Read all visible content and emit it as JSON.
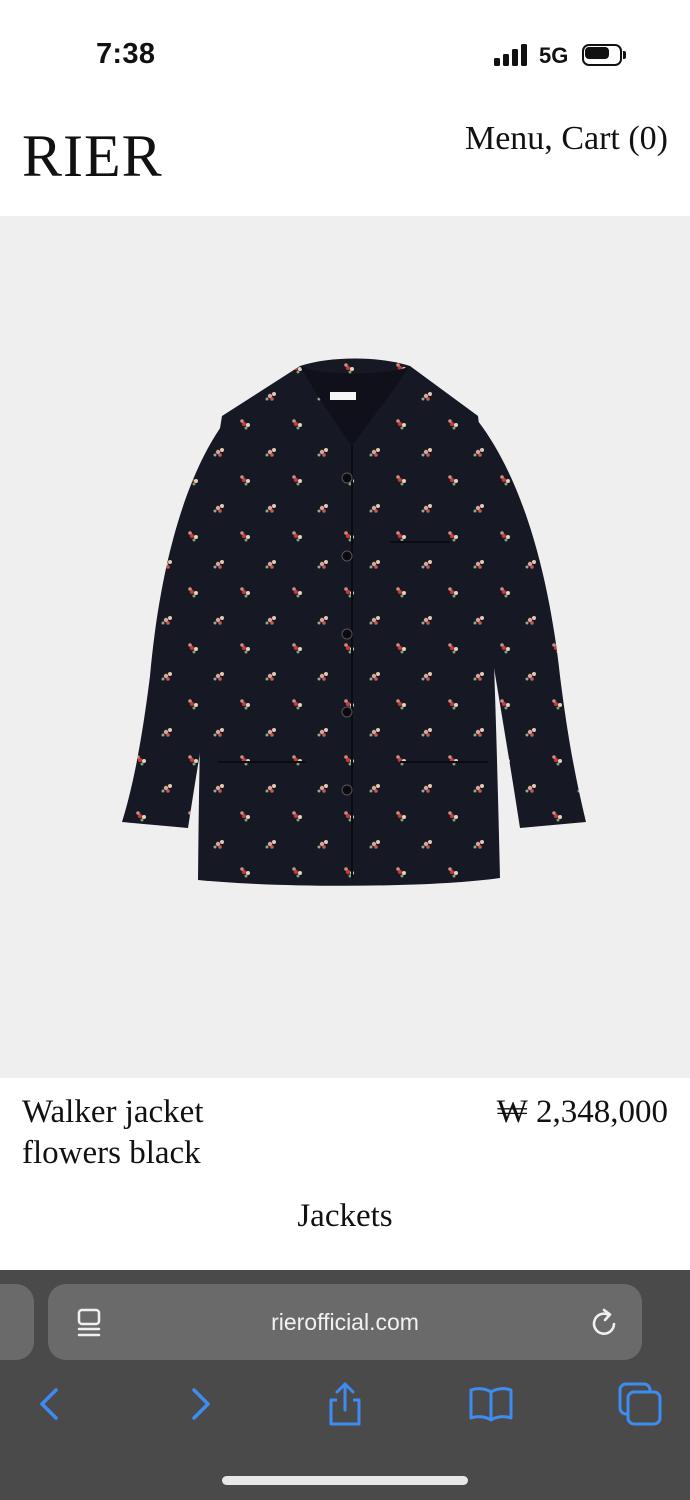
{
  "status_bar": {
    "time": "7:38",
    "network": "5G",
    "icons": [
      "signal-icon",
      "battery-icon"
    ]
  },
  "header": {
    "brand": "RIER",
    "menu_label": "Menu,",
    "cart_label": "Cart (0)"
  },
  "product": {
    "image": "walker-jacket-product-photo",
    "name_line1": "Walker jacket",
    "name_line2": "flowers black",
    "price": "₩ 2,348,000",
    "category": "Jackets"
  },
  "browser": {
    "url": "rierofficial.com",
    "icons": [
      "tab-overview-icon",
      "reload-icon",
      "back-icon",
      "forward-icon",
      "share-icon",
      "bookmarks-icon",
      "tabs-icon"
    ]
  },
  "colors": {
    "image_background": "#efefef",
    "jacket": "#161824",
    "browser_bar": "#4a4a4a",
    "toolbar_icon": "#3f8cf0"
  }
}
